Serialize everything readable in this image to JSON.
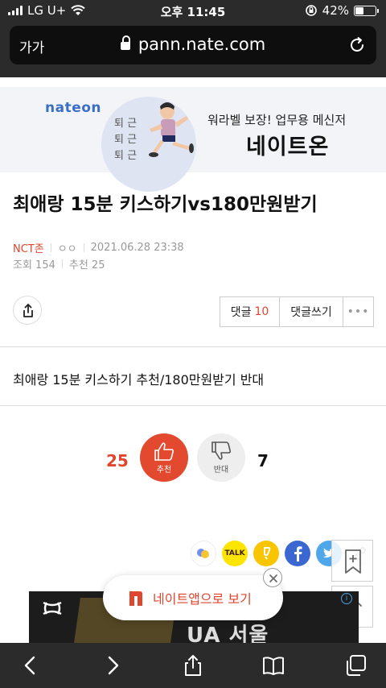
{
  "status": {
    "carrier": "LG U+",
    "time": "오후 11:45",
    "battery": "42%"
  },
  "browser": {
    "text_size_label": "가가",
    "domain": "pann.nate.com"
  },
  "ad_top": {
    "logo": "nateon",
    "vertical_text": [
      "퇴 근",
      "퇴 근",
      "퇴 근"
    ],
    "subtitle": "워라벨 보장! 업무용 메신저",
    "headline": "네이트온"
  },
  "article": {
    "title": "최애랑 15분 키스하기vs180만원받기",
    "category": "NCT존",
    "author": "ㅇㅇ",
    "date": "2021.06.28 23:38",
    "views": "조회 154",
    "recommends": "추천 25",
    "body": "최애랑 15분 키스하기 추천/180만원받기 반대"
  },
  "actions": {
    "comment_label": "댓글",
    "comment_count": "10",
    "write_comment": "댓글쓰기",
    "more": "•••"
  },
  "vote": {
    "up_count": "25",
    "up_label": "추천",
    "down_count": "7",
    "down_label": "반대"
  },
  "social": {
    "kakaotalk": "TALK"
  },
  "app_banner": {
    "label": "네이트앱으로 보기"
  },
  "ad_bottom": {
    "text": "UA 서울",
    "brand_logo": "under-armour",
    "info_icon": "i"
  },
  "colors": {
    "accent": "#e0452d",
    "chrome": "#2b2b2b",
    "nateon_blue": "#3a6fc4"
  }
}
